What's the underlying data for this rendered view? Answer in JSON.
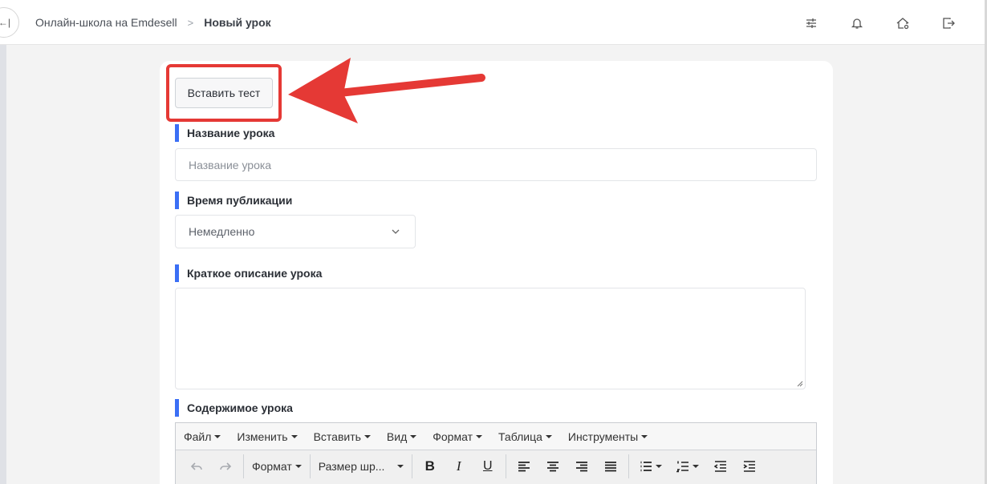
{
  "header": {
    "breadcrumb_root": "Онлайн-школа на Emdesell",
    "breadcrumb_separator": ">",
    "breadcrumb_current": "Новый урок",
    "icons": [
      "collapse-sidebar-icon",
      "settings-sliders-icon",
      "bell-icon",
      "home-settings-icon",
      "logout-icon"
    ]
  },
  "form": {
    "insert_test_label": "Вставить тест",
    "title_label": "Название урока",
    "title_placeholder": "Название урока",
    "publish_label": "Время публикации",
    "publish_value": "Немедленно",
    "description_label": "Краткое описание урока",
    "content_label": "Содержимое урока"
  },
  "editor": {
    "menu": [
      "Файл",
      "Изменить",
      "Вставить",
      "Вид",
      "Формат",
      "Таблица",
      "Инструменты"
    ],
    "format_dropdown": "Формат",
    "font_size_dropdown": "Размер шр...",
    "bold": "B",
    "italic": "I",
    "underline": "U"
  },
  "annotation": {
    "highlight_color": "#e53935",
    "accent_color": "#3b6ff5"
  }
}
